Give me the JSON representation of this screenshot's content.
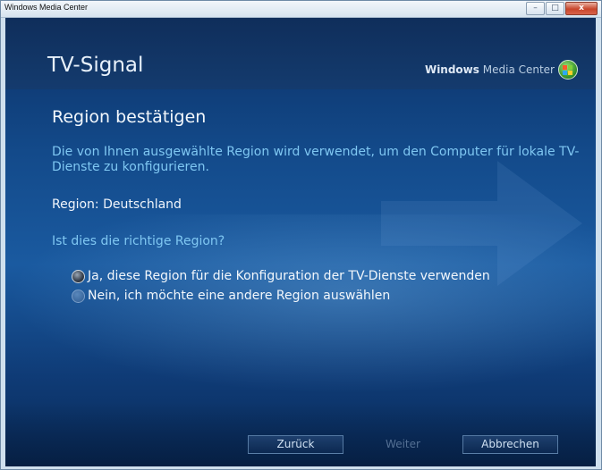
{
  "window": {
    "title": "Windows Media Center",
    "minimize": "–",
    "maximize": "□",
    "close": "x"
  },
  "header": {
    "page_title": "TV-Signal",
    "brand_bold": "Windows",
    "brand_light": "Media Center"
  },
  "main": {
    "heading": "Region bestätigen",
    "description": "Die von Ihnen ausgewählte Region wird verwendet, um den Computer für lokale TV-Dienste zu konfigurieren.",
    "region_line": "Region: Deutschland",
    "question": "Ist dies die richtige Region?",
    "options": [
      {
        "label": "Ja, diese Region für die Konfiguration der TV-Dienste verwenden",
        "selected": true
      },
      {
        "label": "Nein, ich möchte eine andere Region auswählen",
        "selected": false
      }
    ]
  },
  "footer": {
    "back": "Zurück",
    "next": "Weiter",
    "cancel": "Abbrechen"
  },
  "colors": {
    "background": "#134a8a",
    "accent_text": "#7fc7f2"
  }
}
